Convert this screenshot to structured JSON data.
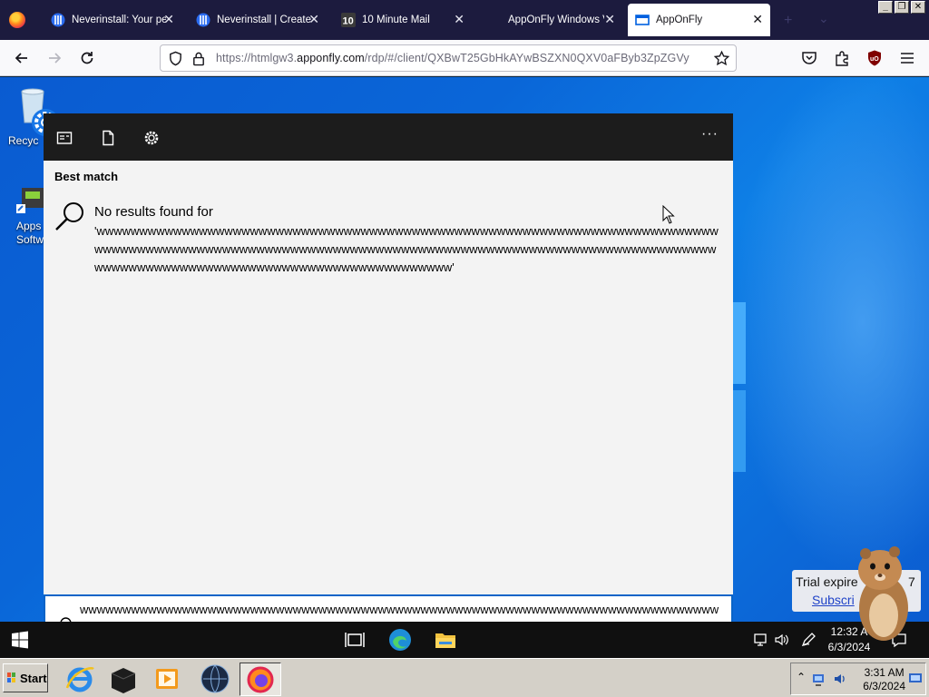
{
  "browser": {
    "tabs": [
      {
        "title": "Neverinstall: Your pe",
        "active": false,
        "favicon": "neverinstall-icon"
      },
      {
        "title": "Neverinstall | Create",
        "active": false,
        "favicon": "neverinstall-icon"
      },
      {
        "title": "10 Minute Mail",
        "active": false,
        "favicon": "10-minute-mail-icon"
      },
      {
        "title": "AppOnFly Windows V",
        "active": false,
        "favicon": "none"
      },
      {
        "title": "AppOnFly",
        "active": true,
        "favicon": "apponfly-icon"
      }
    ],
    "url_prefix": "https://htmlgw3.",
    "url_domain": "apponfly.com",
    "url_suffix": "/rdp/#/client/QXBwT25GbHkAYwBSZXN0QXV0aFByb3ZpZGVy",
    "window_buttons": [
      "_",
      "❐",
      "✕"
    ]
  },
  "desktop": {
    "icons": [
      {
        "label_line1": "Recyc",
        "icon": "recycle-bin-icon"
      },
      {
        "label_line1": "Apps",
        "label_line2": "Softw",
        "icon": "apps-software-icon"
      }
    ]
  },
  "search": {
    "section_title": "Best match",
    "no_results": "No results found for",
    "query_display": "'wwwwwwwwwwwwwwwwwwwwwwwwwwwwwwwwwwwwwwwwwwwwwwwwwwwwwwwwwwwwwwwwwwwwwwwwwwwwwwwwwwwwwwwwwwwwwwwwwwwwwwwwwwwwwwwwwwwwwwwwwwwwwwwwwwwwwwwwwwwwwwwwwwwwwwwwwwwwwwwwwwwwwwwwwwwwwwwwwwwwwwwwwwww'",
    "input_value": "wwwwwwwwwwwwwwwwwwwwwwwwwwwwwwwwwwwwwwwwwwwwwwwwwwwwwwwwwwwwwwwwwwwwwwwwwwwwwwwwwwwwwwwwwwwwwwwwwwwwwwwwwwwwwwwwwwwwwwwwwwwwwwwwwwwwwwwwwwwwwwwwwwwwwwwwwwwwwwwwwwwwwwwwwwwwwwwwwwwwwwwwwwwwwwwwwwwwwwwww",
    "more_label": "···"
  },
  "remote_taskbar": {
    "clock_time": "12:32 A",
    "clock_date": "6/3/2024"
  },
  "trial_notice": {
    "text": "Trial expire",
    "suffix": "7",
    "link": "Subscri"
  },
  "host_taskbar": {
    "start_label": "Start",
    "clock_time": "3:31 AM",
    "clock_date": "6/3/2024"
  },
  "colors": {
    "tab_strip": "#1c1b3e",
    "accent_blue": "#0a64c8",
    "desktop_blue": "#0a66d8",
    "search_header": "#1c1c1c"
  }
}
